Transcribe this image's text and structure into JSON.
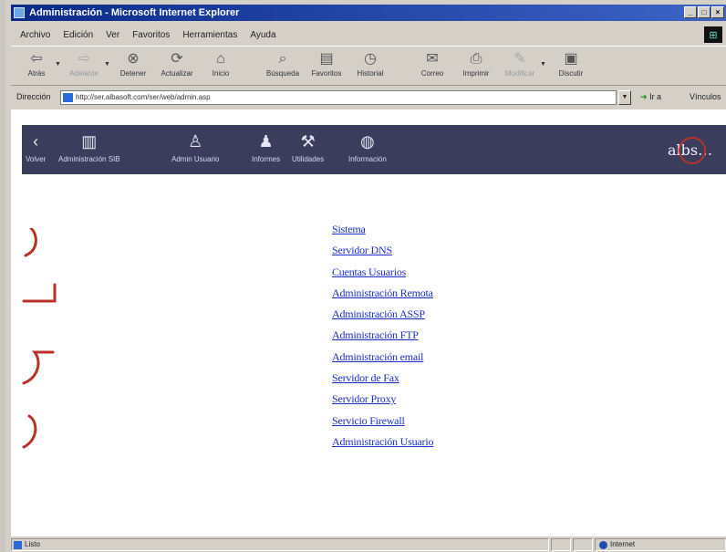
{
  "window": {
    "title": "Administración - Microsoft Internet Explorer"
  },
  "menu": [
    "Archivo",
    "Edición",
    "Ver",
    "Favoritos",
    "Herramientas",
    "Ayuda"
  ],
  "toolbar": {
    "back": "Atrás",
    "forward": "Adelante",
    "stop": "Detener",
    "refresh": "Actualizar",
    "home": "Inicio",
    "search": "Búsqueda",
    "favorites": "Favoritos",
    "history": "Historial",
    "mail": "Correo",
    "print": "Imprimir",
    "edit": "Modificar",
    "discuss": "Discutir"
  },
  "address": {
    "label": "Dirección",
    "url": "http://ser.albasoft.com/ser/web/admin.asp",
    "go": "Ir a",
    "links": "Vínculos"
  },
  "nav": {
    "items": [
      "Volver",
      "Administración SIB",
      "Admin Usuario",
      "Informes",
      "Utilidades",
      "Información"
    ],
    "logo": "albs"
  },
  "links": [
    "Sistema",
    "Servidor DNS",
    "Cuentas Usuarios",
    "Administración Remota",
    "Administración ASSP",
    "Administración FTP",
    "Administración email",
    "Servidor de Fax",
    "Servidor Proxy",
    "Servicio Firewall",
    "Administración Usuario"
  ],
  "status": {
    "text": "Listo",
    "zone": "Internet"
  },
  "colors": {
    "nav_bg": "#3b3d5c",
    "link": "#1b2fc9",
    "annotation": "#b8322a"
  }
}
